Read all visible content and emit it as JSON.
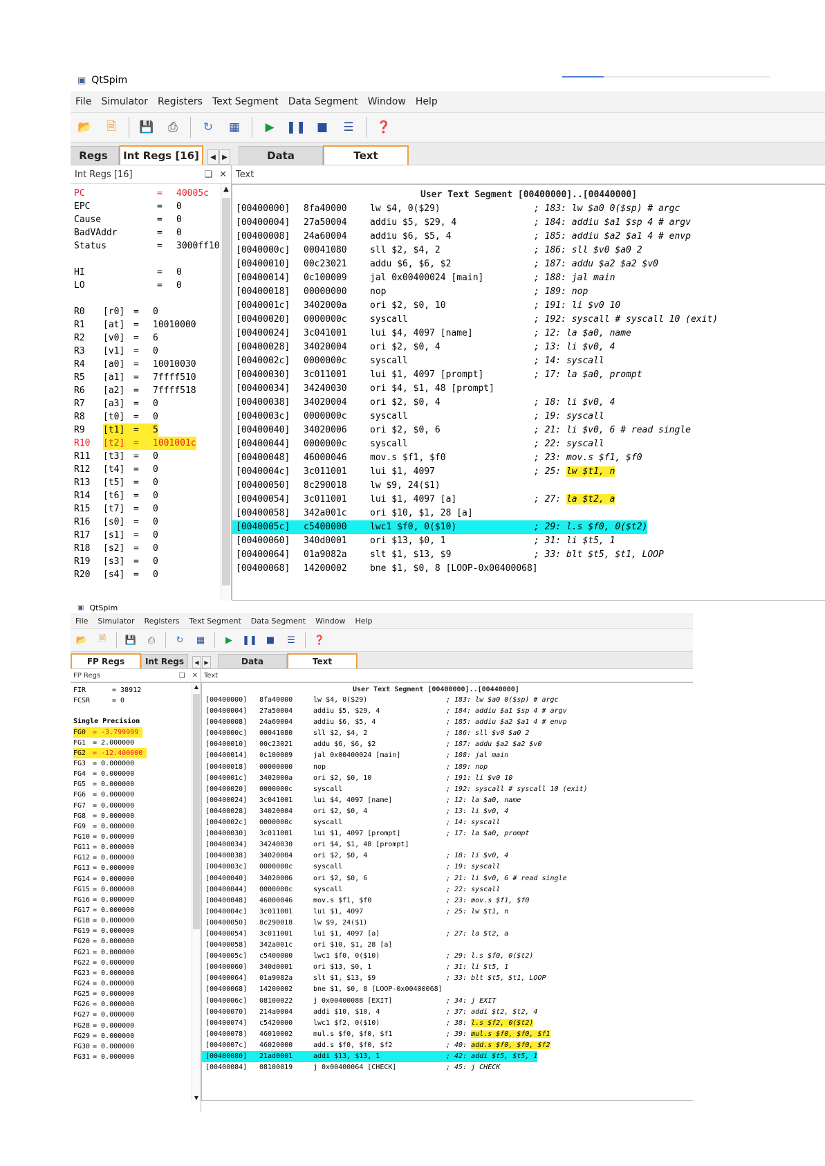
{
  "colors": {
    "breakpoint_highlight": "#ffec2e",
    "current_pc": "#19f0f0",
    "changed_value": "#e8202a",
    "active_tab_border": "#f0a040"
  },
  "window1": {
    "title": "QtSpim",
    "progress_fraction": 0.2,
    "menu": [
      "File",
      "Simulator",
      "Registers",
      "Text Segment",
      "Data Segment",
      "Window",
      "Help"
    ],
    "toolbar_icons": [
      "open-file-icon",
      "reload-icon",
      "save-icon",
      "print-icon",
      "refresh-icon",
      "grid-icon",
      "run-icon",
      "pause-icon",
      "stop-icon",
      "step-icon",
      "help-icon"
    ],
    "left_tabs": [
      {
        "label": "Regs",
        "active": false
      },
      {
        "label": "Int Regs [16]",
        "active": true
      }
    ],
    "right_tabs": [
      {
        "label": "Data",
        "active": false
      },
      {
        "label": "Text",
        "active": true
      }
    ],
    "left_dock_title": "Int Regs [16]",
    "right_dock_title": "Text",
    "special_regs": [
      {
        "name": "PC",
        "value": "40005c",
        "changed": true
      },
      {
        "name": "EPC",
        "value": "0"
      },
      {
        "name": "Cause",
        "value": "0"
      },
      {
        "name": "BadVAddr",
        "value": "0"
      },
      {
        "name": "Status",
        "value": "3000ff10"
      },
      {
        "blank": true
      },
      {
        "name": "HI",
        "value": "0"
      },
      {
        "name": "LO",
        "value": "0"
      },
      {
        "blank": true
      }
    ],
    "gp_regs": [
      {
        "name": "R0",
        "alias": "[r0]",
        "value": "0"
      },
      {
        "name": "R1",
        "alias": "[at]",
        "value": "10010000"
      },
      {
        "name": "R2",
        "alias": "[v0]",
        "value": "6"
      },
      {
        "name": "R3",
        "alias": "[v1]",
        "value": "0"
      },
      {
        "name": "R4",
        "alias": "[a0]",
        "value": "10010030"
      },
      {
        "name": "R5",
        "alias": "[a1]",
        "value": "7ffff510"
      },
      {
        "name": "R6",
        "alias": "[a2]",
        "value": "7ffff518"
      },
      {
        "name": "R7",
        "alias": "[a3]",
        "value": "0"
      },
      {
        "name": "R8",
        "alias": "[t0]",
        "value": "0"
      },
      {
        "name": "R9",
        "alias": "[t1]",
        "value": "5",
        "highlight": true
      },
      {
        "name": "R10",
        "alias": "[t2]",
        "value": "1001001c",
        "highlight": true,
        "changed": true
      },
      {
        "name": "R11",
        "alias": "[t3]",
        "value": "0"
      },
      {
        "name": "R12",
        "alias": "[t4]",
        "value": "0"
      },
      {
        "name": "R13",
        "alias": "[t5]",
        "value": "0"
      },
      {
        "name": "R14",
        "alias": "[t6]",
        "value": "0"
      },
      {
        "name": "R15",
        "alias": "[t7]",
        "value": "0"
      },
      {
        "name": "R16",
        "alias": "[s0]",
        "value": "0"
      },
      {
        "name": "R17",
        "alias": "[s1]",
        "value": "0"
      },
      {
        "name": "R18",
        "alias": "[s2]",
        "value": "0"
      },
      {
        "name": "R19",
        "alias": "[s3]",
        "value": "0"
      },
      {
        "name": "R20",
        "alias": "[s4]",
        "value": "0"
      }
    ],
    "segment_header": "User Text Segment [00400000]..[00440000]",
    "code": [
      {
        "addr": "[00400000]",
        "hex": "8fa40000",
        "instr": "lw $4, 0($29)",
        "src": "; 183: lw $a0 0($sp) # argc"
      },
      {
        "addr": "[00400004]",
        "hex": "27a50004",
        "instr": "addiu $5, $29, 4",
        "src": "; 184: addiu $a1 $sp 4 # argv"
      },
      {
        "addr": "[00400008]",
        "hex": "24a60004",
        "instr": "addiu $6, $5, 4",
        "src": "; 185: addiu $a2 $a1 4 # envp"
      },
      {
        "addr": "[0040000c]",
        "hex": "00041080",
        "instr": "sll $2, $4, 2",
        "src": "; 186: sll $v0 $a0 2"
      },
      {
        "addr": "[00400010]",
        "hex": "00c23021",
        "instr": "addu $6, $6, $2",
        "src": "; 187: addu $a2 $a2 $v0"
      },
      {
        "addr": "[00400014]",
        "hex": "0c100009",
        "instr": "jal 0x00400024 [main]",
        "src": "; 188: jal main"
      },
      {
        "addr": "[00400018]",
        "hex": "00000000",
        "instr": "nop",
        "src": "; 189: nop"
      },
      {
        "addr": "[0040001c]",
        "hex": "3402000a",
        "instr": "ori $2, $0, 10",
        "src": "; 191: li $v0 10"
      },
      {
        "addr": "[00400020]",
        "hex": "0000000c",
        "instr": "syscall",
        "src": "; 192: syscall # syscall 10 (exit)"
      },
      {
        "addr": "[00400024]",
        "hex": "3c041001",
        "instr": "lui $4, 4097 [name]",
        "src": "; 12: la $a0, name"
      },
      {
        "addr": "[00400028]",
        "hex": "34020004",
        "instr": "ori $2, $0, 4",
        "src": "; 13: li $v0, 4"
      },
      {
        "addr": "[0040002c]",
        "hex": "0000000c",
        "instr": "syscall",
        "src": "; 14: syscall"
      },
      {
        "addr": "[00400030]",
        "hex": "3c011001",
        "instr": "lui $1, 4097 [prompt]",
        "src": "; 17: la $a0, prompt"
      },
      {
        "addr": "[00400034]",
        "hex": "34240030",
        "instr": "ori $4, $1, 48 [prompt]",
        "src": ""
      },
      {
        "addr": "[00400038]",
        "hex": "34020004",
        "instr": "ori $2, $0, 4",
        "src": "; 18: li $v0, 4"
      },
      {
        "addr": "[0040003c]",
        "hex": "0000000c",
        "instr": "syscall",
        "src": "; 19: syscall"
      },
      {
        "addr": "[00400040]",
        "hex": "34020006",
        "instr": "ori $2, $0, 6",
        "src": "; 21: li $v0, 6 # read single"
      },
      {
        "addr": "[00400044]",
        "hex": "0000000c",
        "instr": "syscall",
        "src": "; 22: syscall"
      },
      {
        "addr": "[00400048]",
        "hex": "46000046",
        "instr": "mov.s $f1, $f0",
        "src": "; 23: mov.s $f1, $f0"
      },
      {
        "addr": "[0040004c]",
        "hex": "3c011001",
        "instr": "lui $1, 4097",
        "src": "; 25:",
        "src_hl": "lw $t1, n"
      },
      {
        "addr": "[00400050]",
        "hex": "8c290018",
        "instr": "lw $9, 24($1)",
        "src": ""
      },
      {
        "addr": "[00400054]",
        "hex": "3c011001",
        "instr": "lui $1, 4097 [a]",
        "src": "; 27:",
        "src_hl": "la $t2, a"
      },
      {
        "addr": "[00400058]",
        "hex": "342a001c",
        "instr": "ori $10, $1, 28 [a]",
        "src": ""
      },
      {
        "addr": "[0040005c]",
        "hex": "c5400000",
        "instr": "lwc1 $f0, 0($10)",
        "src": "; 29: l.s $f0, 0($t2)",
        "current": true
      },
      {
        "addr": "[00400060]",
        "hex": "340d0001",
        "instr": "ori $13, $0, 1",
        "src": "; 31: li $t5, 1"
      },
      {
        "addr": "[00400064]",
        "hex": "01a9082a",
        "instr": "slt $1, $13, $9",
        "src": "; 33: blt $t5, $t1, LOOP"
      },
      {
        "addr": "[00400068]",
        "hex": "14200002",
        "instr": "bne $1, $0, 8 [LOOP-0x00400068]",
        "src": ""
      }
    ]
  },
  "window2": {
    "title": "QtSpim",
    "menu": [
      "File",
      "Simulator",
      "Registers",
      "Text Segment",
      "Data Segment",
      "Window",
      "Help"
    ],
    "toolbar_icons": [
      "open-file-icon",
      "reload-icon",
      "save-icon",
      "print-icon",
      "refresh-icon",
      "grid-icon",
      "run-icon",
      "pause-icon",
      "stop-icon",
      "step-icon",
      "help-icon"
    ],
    "left_tabs": [
      {
        "label": "FP Regs",
        "active": true
      },
      {
        "label": "Int Regs",
        "active": false
      }
    ],
    "right_tabs": [
      {
        "label": "Data",
        "active": false
      },
      {
        "label": "Text",
        "active": true
      }
    ],
    "left_dock_title": "FP Regs",
    "right_dock_title": "Text",
    "fp_special": [
      {
        "name": "FIR",
        "value": "= 38912"
      },
      {
        "name": "FCSR",
        "value": "= 0"
      },
      {
        "blank": true
      },
      {
        "name": "Single Precision",
        "value": "",
        "header": true
      }
    ],
    "fp_regs": [
      {
        "name": "FG0",
        "value": "= -3.799999",
        "highlight": true
      },
      {
        "name": "FG1",
        "value": "= 2.000000"
      },
      {
        "name": "FG2",
        "value": "= -12.400000",
        "highlight": true
      },
      {
        "name": "FG3",
        "value": "= 0.000000"
      },
      {
        "name": "FG4",
        "value": "= 0.000000"
      },
      {
        "name": "FG5",
        "value": "= 0.000000"
      },
      {
        "name": "FG6",
        "value": "= 0.000000"
      },
      {
        "name": "FG7",
        "value": "= 0.000000"
      },
      {
        "name": "FG8",
        "value": "= 0.000000"
      },
      {
        "name": "FG9",
        "value": "= 0.000000"
      },
      {
        "name": "FG10",
        "value": "= 0.000000"
      },
      {
        "name": "FG11",
        "value": "= 0.000000"
      },
      {
        "name": "FG12",
        "value": "= 0.000000"
      },
      {
        "name": "FG13",
        "value": "= 0.000000"
      },
      {
        "name": "FG14",
        "value": "= 0.000000"
      },
      {
        "name": "FG15",
        "value": "= 0.000000"
      },
      {
        "name": "FG16",
        "value": "= 0.000000"
      },
      {
        "name": "FG17",
        "value": "= 0.000000"
      },
      {
        "name": "FG18",
        "value": "= 0.000000"
      },
      {
        "name": "FG19",
        "value": "= 0.000000"
      },
      {
        "name": "FG20",
        "value": "= 0.000000"
      },
      {
        "name": "FG21",
        "value": "= 0.000000"
      },
      {
        "name": "FG22",
        "value": "= 0.000000"
      },
      {
        "name": "FG23",
        "value": "= 0.000000"
      },
      {
        "name": "FG24",
        "value": "= 0.000000"
      },
      {
        "name": "FG25",
        "value": "= 0.000000"
      },
      {
        "name": "FG26",
        "value": "= 0.000000"
      },
      {
        "name": "FG27",
        "value": "= 0.000000"
      },
      {
        "name": "FG28",
        "value": "= 0.000000"
      },
      {
        "name": "FG29",
        "value": "= 0.000000"
      },
      {
        "name": "FG30",
        "value": "= 0.000000"
      },
      {
        "name": "FG31",
        "value": "= 0.000000"
      }
    ],
    "segment_header": "User Text Segment [00400000]..[00440000]",
    "code": [
      {
        "addr": "[00400000]",
        "hex": "8fa40000",
        "instr": "lw $4, 0($29)",
        "src": "; 183: lw $a0 0($sp) # argc"
      },
      {
        "addr": "[00400004]",
        "hex": "27a50004",
        "instr": "addiu $5, $29, 4",
        "src": "; 184: addiu $a1 $sp 4 # argv"
      },
      {
        "addr": "[00400008]",
        "hex": "24a60004",
        "instr": "addiu $6, $5, 4",
        "src": "; 185: addiu $a2 $a1 4 # envp"
      },
      {
        "addr": "[0040000c]",
        "hex": "00041080",
        "instr": "sll $2, $4, 2",
        "src": "; 186: sll $v0 $a0 2"
      },
      {
        "addr": "[00400010]",
        "hex": "00c23021",
        "instr": "addu $6, $6, $2",
        "src": "; 187: addu $a2 $a2 $v0"
      },
      {
        "addr": "[00400014]",
        "hex": "0c100009",
        "instr": "jal 0x00400024 [main]",
        "src": "; 188: jal main"
      },
      {
        "addr": "[00400018]",
        "hex": "00000000",
        "instr": "nop",
        "src": "; 189: nop"
      },
      {
        "addr": "[0040001c]",
        "hex": "3402000a",
        "instr": "ori $2, $0, 10",
        "src": "; 191: li $v0 10"
      },
      {
        "addr": "[00400020]",
        "hex": "0000000c",
        "instr": "syscall",
        "src": "; 192: syscall # syscall 10 (exit)"
      },
      {
        "addr": "[00400024]",
        "hex": "3c041001",
        "instr": "lui $4, 4097 [name]",
        "src": "; 12: la $a0, name"
      },
      {
        "addr": "[00400028]",
        "hex": "34020004",
        "instr": "ori $2, $0, 4",
        "src": "; 13: li $v0, 4"
      },
      {
        "addr": "[0040002c]",
        "hex": "0000000c",
        "instr": "syscall",
        "src": "; 14: syscall"
      },
      {
        "addr": "[00400030]",
        "hex": "3c011001",
        "instr": "lui $1, 4097 [prompt]",
        "src": "; 17: la $a0, prompt"
      },
      {
        "addr": "[00400034]",
        "hex": "34240030",
        "instr": "ori $4, $1, 48 [prompt]",
        "src": ""
      },
      {
        "addr": "[00400038]",
        "hex": "34020004",
        "instr": "ori $2, $0, 4",
        "src": "; 18: li $v0, 4"
      },
      {
        "addr": "[0040003c]",
        "hex": "0000000c",
        "instr": "syscall",
        "src": "; 19: syscall"
      },
      {
        "addr": "[00400040]",
        "hex": "34020006",
        "instr": "ori $2, $0, 6",
        "src": "; 21: li $v0, 6 # read single"
      },
      {
        "addr": "[00400044]",
        "hex": "0000000c",
        "instr": "syscall",
        "src": "; 22: syscall"
      },
      {
        "addr": "[00400048]",
        "hex": "46000046",
        "instr": "mov.s $f1, $f0",
        "src": "; 23: mov.s $f1, $f0"
      },
      {
        "addr": "[0040004c]",
        "hex": "3c011001",
        "instr": "lui $1, 4097",
        "src": "; 25: lw $t1, n"
      },
      {
        "addr": "[00400050]",
        "hex": "8c290018",
        "instr": "lw $9, 24($1)",
        "src": ""
      },
      {
        "addr": "[00400054]",
        "hex": "3c011001",
        "instr": "lui $1, 4097 [a]",
        "src": "; 27: la $t2, a"
      },
      {
        "addr": "[00400058]",
        "hex": "342a001c",
        "instr": "ori $10, $1, 28 [a]",
        "src": ""
      },
      {
        "addr": "[0040005c]",
        "hex": "c5400000",
        "instr": "lwc1 $f0, 0($10)",
        "src": "; 29: l.s $f0, 0($t2)"
      },
      {
        "addr": "[00400060]",
        "hex": "340d0001",
        "instr": "ori $13, $0, 1",
        "src": "; 31: li $t5, 1"
      },
      {
        "addr": "[00400064]",
        "hex": "01a9082a",
        "instr": "slt $1, $13, $9",
        "src": "; 33: blt $t5, $t1, LOOP"
      },
      {
        "addr": "[00400068]",
        "hex": "14200002",
        "instr": "bne $1, $0, 8 [LOOP-0x00400068]",
        "src": ""
      },
      {
        "addr": "[0040006c]",
        "hex": "08100022",
        "instr": "j 0x00400088 [EXIT]",
        "src": "; 34: j EXIT"
      },
      {
        "addr": "[00400070]",
        "hex": "214a0004",
        "instr": "addi $10, $10, 4",
        "src": "; 37: addi $t2, $t2, 4"
      },
      {
        "addr": "[00400074]",
        "hex": "c5420000",
        "instr": "lwc1 $f2, 0($10)",
        "src": "; 38:",
        "src_hl": "l.s $f2, 0($t2)"
      },
      {
        "addr": "[00400078]",
        "hex": "46010002",
        "instr": "mul.s $f0, $f0, $f1",
        "src": "; 39:",
        "src_hl": "mul.s $f0, $f0, $f1"
      },
      {
        "addr": "[0040007c]",
        "hex": "46020000",
        "instr": "add.s $f0, $f0, $f2",
        "src": "; 40:",
        "src_hl": "add.s $f0, $f0, $f2"
      },
      {
        "addr": "[00400080]",
        "hex": "21ad0001",
        "instr": "addi $13, $13, 1",
        "src": "; 42: addi $t5, $t5, 1",
        "current": true
      },
      {
        "addr": "[00400084]",
        "hex": "08100019",
        "instr": "j 0x00400064 [CHECK]",
        "src": "; 45: j CHECK"
      }
    ]
  }
}
